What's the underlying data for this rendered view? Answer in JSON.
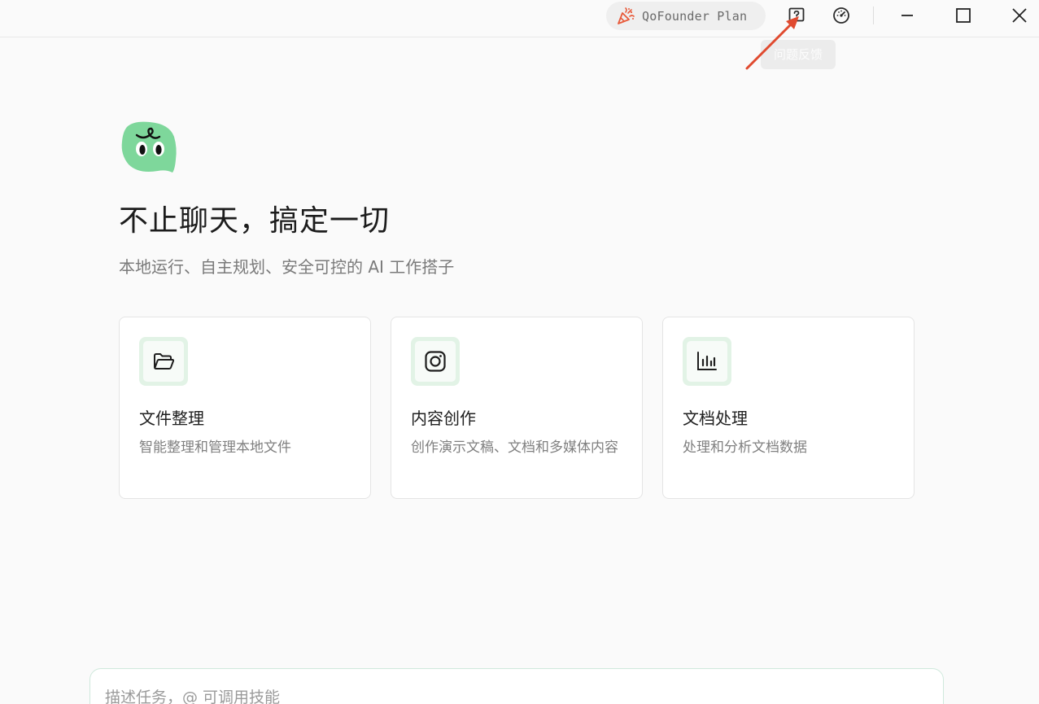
{
  "titlebar": {
    "plan_label": "QoFounder Plan",
    "icons": {
      "plan": "party-popper-icon",
      "feedback": "feedback-question-icon",
      "dashboard": "speedometer-icon"
    },
    "tooltip": "问题反馈"
  },
  "hero": {
    "title": "不止聊天，搞定一切",
    "subtitle": "本地运行、自主规划、安全可控的 AI 工作搭子"
  },
  "cards": [
    {
      "icon": "folder-open-icon",
      "title": "文件整理",
      "desc": "智能整理和管理本地文件"
    },
    {
      "icon": "instagram-icon",
      "title": "内容创作",
      "desc": "创作演示文稿、文档和多媒体内容"
    },
    {
      "icon": "bar-chart-icon",
      "title": "文档处理",
      "desc": "处理和分析文档数据"
    }
  ],
  "input": {
    "placeholder": "描述任务，@ 可调用技能",
    "value": ""
  },
  "colors": {
    "accent_green": "#7ed79b",
    "icon_box_bg": "#e2f3e6",
    "annotation_red": "#e04a2f"
  }
}
